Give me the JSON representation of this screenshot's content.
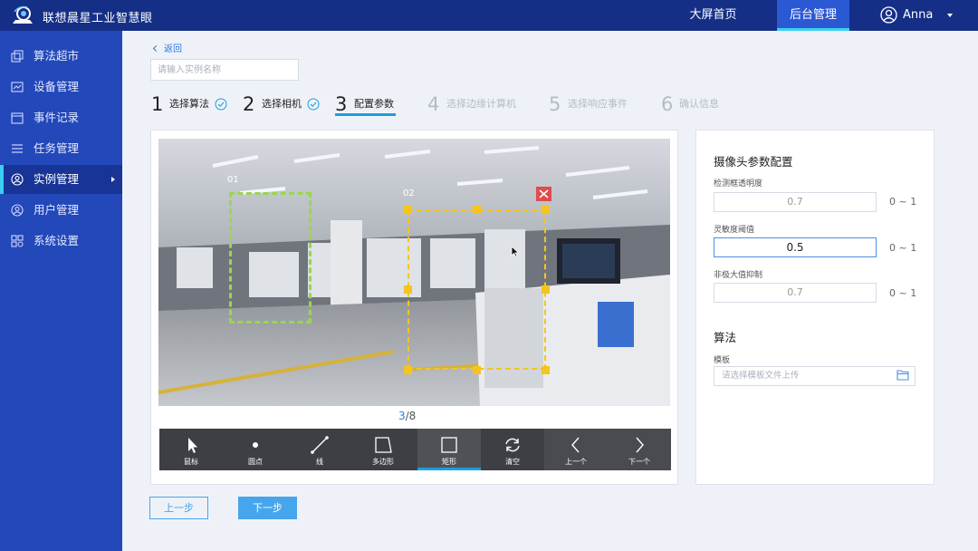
{
  "app": {
    "title": "联想晨星工业智慧眼"
  },
  "topnav": {
    "home": "大屏首页",
    "admin": "后台管理",
    "user": "Anna"
  },
  "sidebar": {
    "items": [
      {
        "label": "算法超市",
        "icon": "store-icon"
      },
      {
        "label": "设备管理",
        "icon": "device-icon"
      },
      {
        "label": "事件记录",
        "icon": "record-icon"
      },
      {
        "label": "任务管理",
        "icon": "task-icon"
      },
      {
        "label": "实例管理",
        "icon": "instance-icon",
        "active": true
      },
      {
        "label": "用户管理",
        "icon": "user-icon"
      },
      {
        "label": "系统设置",
        "icon": "settings-icon"
      }
    ]
  },
  "page": {
    "back": "返回",
    "name_placeholder": "请输入实例名称"
  },
  "steps": [
    {
      "num": "1",
      "label": "选择算法",
      "state": "done"
    },
    {
      "num": "2",
      "label": "选择相机",
      "state": "done"
    },
    {
      "num": "3",
      "label": "配置参数",
      "state": "current"
    },
    {
      "num": "4",
      "label": "选择边缘计算机",
      "state": "pending"
    },
    {
      "num": "5",
      "label": "选择响应事件",
      "state": "pending"
    },
    {
      "num": "6",
      "label": "确认信息",
      "state": "pending"
    }
  ],
  "canvas": {
    "regions": [
      {
        "label": "01",
        "color": "#9ad64e"
      },
      {
        "label": "02",
        "color": "#f5c51e"
      }
    ],
    "pager": {
      "current": "3",
      "total": "/8"
    }
  },
  "toolbar": {
    "tools": [
      {
        "label": "鼠标",
        "icon": "cursor-icon"
      },
      {
        "label": "圆点",
        "icon": "dot-icon"
      },
      {
        "label": "线",
        "icon": "line-icon"
      },
      {
        "label": "多边形",
        "icon": "polygon-icon"
      },
      {
        "label": "矩形",
        "icon": "rectangle-icon",
        "active": true
      },
      {
        "label": "清空",
        "icon": "refresh-icon"
      },
      {
        "label": "上一个",
        "icon": "chevron-left-icon"
      },
      {
        "label": "下一个",
        "icon": "chevron-right-icon"
      }
    ]
  },
  "params": {
    "title": "摄像头参数配置",
    "fields": [
      {
        "label": "检测框透明度",
        "value": "0.7",
        "range": "0 ~ 1"
      },
      {
        "label": "灵敏度阈值",
        "value": "0.5",
        "range": "0 ~ 1",
        "focused": true
      },
      {
        "label": "非极大值抑制",
        "value": "0.7",
        "range": "0 ~ 1"
      }
    ]
  },
  "algorithm": {
    "title": "算法",
    "template_label": "模板",
    "template_placeholder": "请选择模板文件上传"
  },
  "buttons": {
    "prev": "上一步",
    "next": "下一步"
  },
  "colors": {
    "topbar": "#152f87",
    "sidebar": "#2348b9",
    "accent": "#1e9fda",
    "primary": "#45a6ee"
  }
}
